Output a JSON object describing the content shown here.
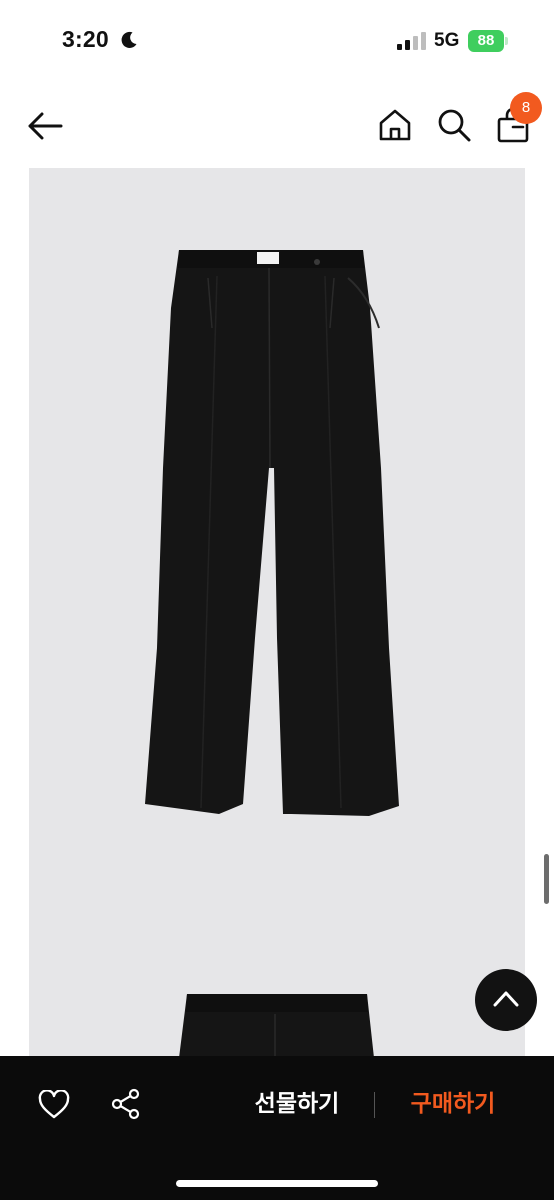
{
  "status_bar": {
    "time": "3:20",
    "network": "5G",
    "battery": "88"
  },
  "nav": {
    "cart_count": "8"
  },
  "bottom_bar": {
    "gift_label": "선물하기",
    "buy_label": "구매하기"
  },
  "colors": {
    "accent": "#f25a1f",
    "battery": "#3fce5e",
    "bar_background": "#0b0b0b",
    "image_background": "#e6e6e8"
  },
  "icons": [
    "moon-icon",
    "signal-icon",
    "battery-icon",
    "back-arrow-icon",
    "home-icon",
    "search-icon",
    "cart-icon",
    "heart-icon",
    "share-icon",
    "chevron-up-icon"
  ]
}
